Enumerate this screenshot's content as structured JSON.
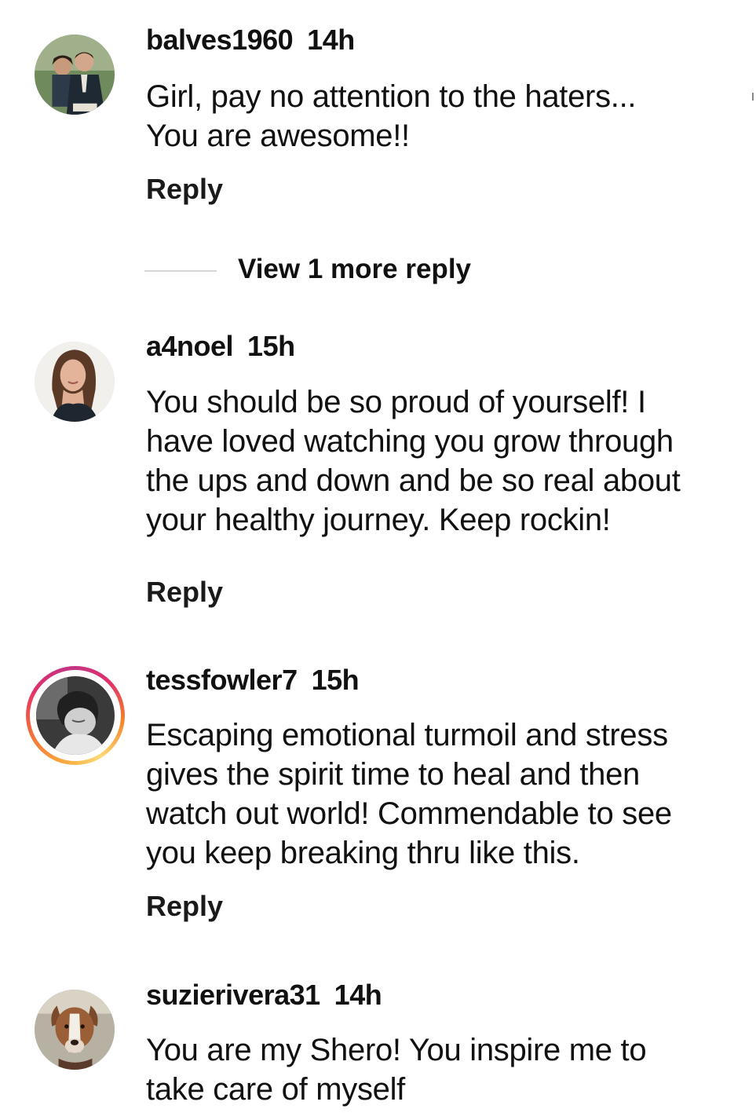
{
  "comments": [
    {
      "username": "balves1960",
      "time": "14h",
      "text": "Girl, pay no attention to the haters...\nYou are  awesome!!",
      "reply_label": "Reply",
      "avatar_icon": "avatar-photo-two-people"
    },
    {
      "username": "a4noel",
      "time": "15h",
      "text": "You should be so proud of yourself! I\nhave loved watching you grow through\nthe ups and down and be so real about\nyour healthy journey. Keep rockin!",
      "reply_label": "Reply",
      "avatar_icon": "avatar-photo-woman"
    },
    {
      "username": "tessfowler7",
      "time": "15h",
      "text": "Escaping emotional turmoil and stress\ngives the spirit time to heal and then\nwatch out world! Commendable to see\nyou keep breaking thru like this.",
      "reply_label": "Reply",
      "avatar_icon": "avatar-photo-bw-portrait",
      "has_story_ring": true
    },
    {
      "username": "suzierivera31",
      "time": "14h",
      "text": "You are my Shero! You inspire me to\ntake care of myself",
      "avatar_icon": "avatar-photo-dog"
    }
  ],
  "view_more": {
    "label": "View 1 more reply"
  },
  "colors": {
    "text": "#111111",
    "divider": "#d6d6d6",
    "ring_gradient": [
      "#feda75",
      "#f58529",
      "#e1306c",
      "#c13584"
    ]
  }
}
